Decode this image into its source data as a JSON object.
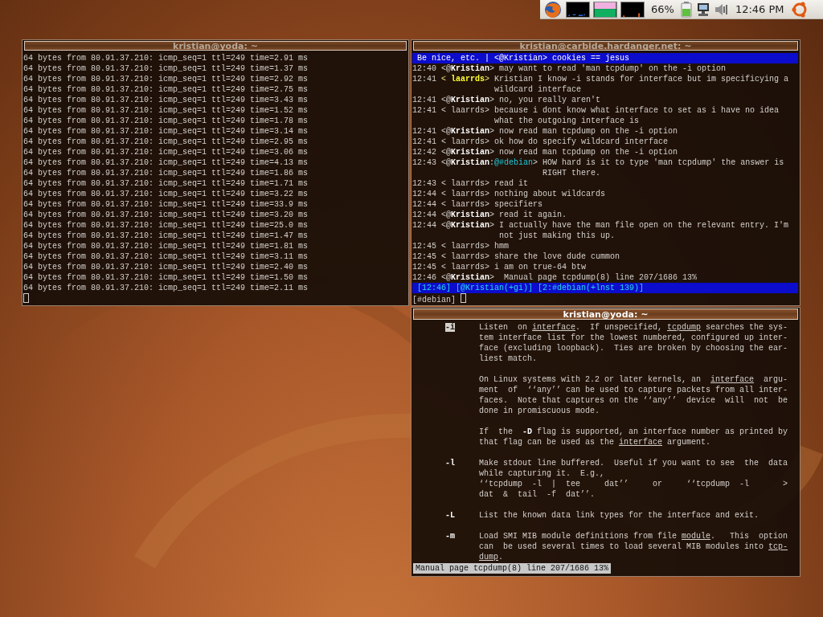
{
  "panel": {
    "battery_percent": "66%",
    "clock": "12:46 PM"
  },
  "windows": [
    {
      "kind": "ping",
      "title": "kristian@yoda: ~",
      "active": false,
      "lines": [
        "64 bytes from 80.91.37.210: icmp_seq=1 ttl=249 time=2.91 ms",
        "64 bytes from 80.91.37.210: icmp_seq=1 ttl=249 time=1.37 ms",
        "64 bytes from 80.91.37.210: icmp_seq=1 ttl=249 time=2.92 ms",
        "64 bytes from 80.91.37.210: icmp_seq=1 ttl=249 time=2.75 ms",
        "64 bytes from 80.91.37.210: icmp_seq=1 ttl=249 time=3.43 ms",
        "64 bytes from 80.91.37.210: icmp_seq=1 ttl=249 time=1.52 ms",
        "64 bytes from 80.91.37.210: icmp_seq=1 ttl=249 time=1.78 ms",
        "64 bytes from 80.91.37.210: icmp_seq=1 ttl=249 time=3.14 ms",
        "64 bytes from 80.91.37.210: icmp_seq=1 ttl=249 time=2.95 ms",
        "64 bytes from 80.91.37.210: icmp_seq=1 ttl=249 time=3.06 ms",
        "64 bytes from 80.91.37.210: icmp_seq=1 ttl=249 time=4.13 ms",
        "64 bytes from 80.91.37.210: icmp_seq=1 ttl=249 time=1.86 ms",
        "64 bytes from 80.91.37.210: icmp_seq=1 ttl=249 time=1.71 ms",
        "64 bytes from 80.91.37.210: icmp_seq=1 ttl=249 time=3.22 ms",
        "64 bytes from 80.91.37.210: icmp_seq=1 ttl=249 time=33.9 ms",
        "64 bytes from 80.91.37.210: icmp_seq=1 ttl=249 time=3.20 ms",
        "64 bytes from 80.91.37.210: icmp_seq=1 ttl=249 time=25.0 ms",
        "64 bytes from 80.91.37.210: icmp_seq=1 ttl=249 time=1.47 ms",
        "64 bytes from 80.91.37.210: icmp_seq=1 ttl=249 time=1.81 ms",
        "64 bytes from 80.91.37.210: icmp_seq=1 ttl=249 time=3.11 ms",
        "64 bytes from 80.91.37.210: icmp_seq=1 ttl=249 time=2.40 ms",
        "64 bytes from 80.91.37.210: icmp_seq=1 ttl=249 time=1.50 ms",
        "64 bytes from 80.91.37.210: icmp_seq=1 ttl=249 time=2.11 ms"
      ]
    },
    {
      "kind": "irc",
      "title": "kristian@carbide.hardanger.net: ~",
      "active": false,
      "topic": "Be nice, etc. | <@Kristian> cookies == jesus",
      "messages": [
        {
          "time": "12:40",
          "nick": "<@**Kristian**>",
          "highlighted": false,
          "text": "may want to read 'man tcpdump' on the -i option"
        },
        {
          "time": "12:41",
          "nick": "< **laarrds**>",
          "highlighted": true,
          "text": "Kristian I know -i stands for interface but im specificying a wildcard interface"
        },
        {
          "time": "12:41",
          "nick": "<@**Kristian**>",
          "highlighted": false,
          "text": "no, you really aren't"
        },
        {
          "time": "12:41",
          "nick": "< laarrds>",
          "highlighted": false,
          "text": "because i dont know what interface to set as i have no idea what the outgoing interface is"
        },
        {
          "time": "12:41",
          "nick": "<@**Kristian**>",
          "highlighted": false,
          "text": "now read man tcpdump on the -i option"
        },
        {
          "time": "12:41",
          "nick": "< laarrds>",
          "highlighted": false,
          "text": "ok how do specify wildcard interface"
        },
        {
          "time": "12:42",
          "nick": "<@**Kristian**>",
          "highlighted": false,
          "text": "now read man tcpdump on the -i option"
        },
        {
          "time": "12:43",
          "nick": "<@**Kristian**:*@#debian*>",
          "highlighted": false,
          "text": "HOW hard is it to type 'man tcpdump' the answer is RIGHT there."
        },
        {
          "time": "12:43",
          "nick": "< laarrds>",
          "highlighted": false,
          "text": "read it"
        },
        {
          "time": "12:44",
          "nick": "< laarrds>",
          "highlighted": false,
          "text": "nothing about wildcards"
        },
        {
          "time": "12:44",
          "nick": "< laarrds>",
          "highlighted": false,
          "text": "specifiers"
        },
        {
          "time": "12:44",
          "nick": "<@**Kristian**>",
          "highlighted": false,
          "text": "read it again."
        },
        {
          "time": "12:44",
          "nick": "<@**Kristian**>",
          "highlighted": false,
          "text": "I actually have the man file open on the relevant entry. I'm not just making this up."
        },
        {
          "time": "12:45",
          "nick": "< laarrds>",
          "highlighted": false,
          "text": "hmm"
        },
        {
          "time": "12:45",
          "nick": "< laarrds>",
          "highlighted": false,
          "text": "share the love dude cummon"
        },
        {
          "time": "12:45",
          "nick": "< laarrds>",
          "highlighted": false,
          "text": "i am on true-64 btw"
        },
        {
          "time": "12:46",
          "nick": "<@**Kristian**>",
          "highlighted": false,
          "text": " Manual page tcpdump(8) line 207/1686 13%"
        }
      ],
      "status": [
        "[12:46]",
        "[@Kristian(+gi)]",
        "[2:#debian(+lnst 139)]"
      ],
      "prompt": "[#debian]"
    },
    {
      "kind": "man",
      "title": "kristian@yoda: ~",
      "active": true,
      "entries": [
        {
          "flag": "-i",
          "highlighted": true,
          "paragraphs": [
            [
              "Listen  on *interface*.  If unspecified, *tcpdump* searches the sys-",
              "tem interface list for the lowest numbered, configured up inter-",
              "face (excluding loopback).  Ties are broken by choosing the ear-",
              "liest match."
            ],
            [
              "On Linux systems with 2.2 or later kernels, an  *interface*  argu-",
              "ment  of  ‘‘any’’ can be used to capture packets from all inter-",
              "faces.  Note that captures on the ‘‘any’’  device  will  not  be",
              "done in promiscuous mode."
            ],
            [
              "If  the  **-D** flag is supported, an interface number as printed by",
              "that flag can be used as the *interface* argument."
            ]
          ]
        },
        {
          "flag": "-l",
          "highlighted": false,
          "paragraphs": [
            [
              "Make stdout line buffered.  Useful if you want to see  the  data",
              "while capturing it.  E.g.,",
              "‘‘tcpdump  -l  |  tee     dat’’     or     ‘‘tcpdump  -l       >",
              "dat  &  tail  -f  dat’’."
            ]
          ]
        },
        {
          "flag": "-L",
          "highlighted": false,
          "paragraphs": [
            [
              "List the known data link types for the interface and exit."
            ]
          ]
        },
        {
          "flag": "-m",
          "highlighted": false,
          "paragraphs": [
            [
              "Load SMI MIB module definitions from file *module*.   This  option",
              "can  be used several times to load several MIB modules into *tcp-*",
              "*dump*."
            ]
          ]
        }
      ],
      "status": "Manual page tcpdump(8) line 207/1686 13%"
    }
  ]
}
